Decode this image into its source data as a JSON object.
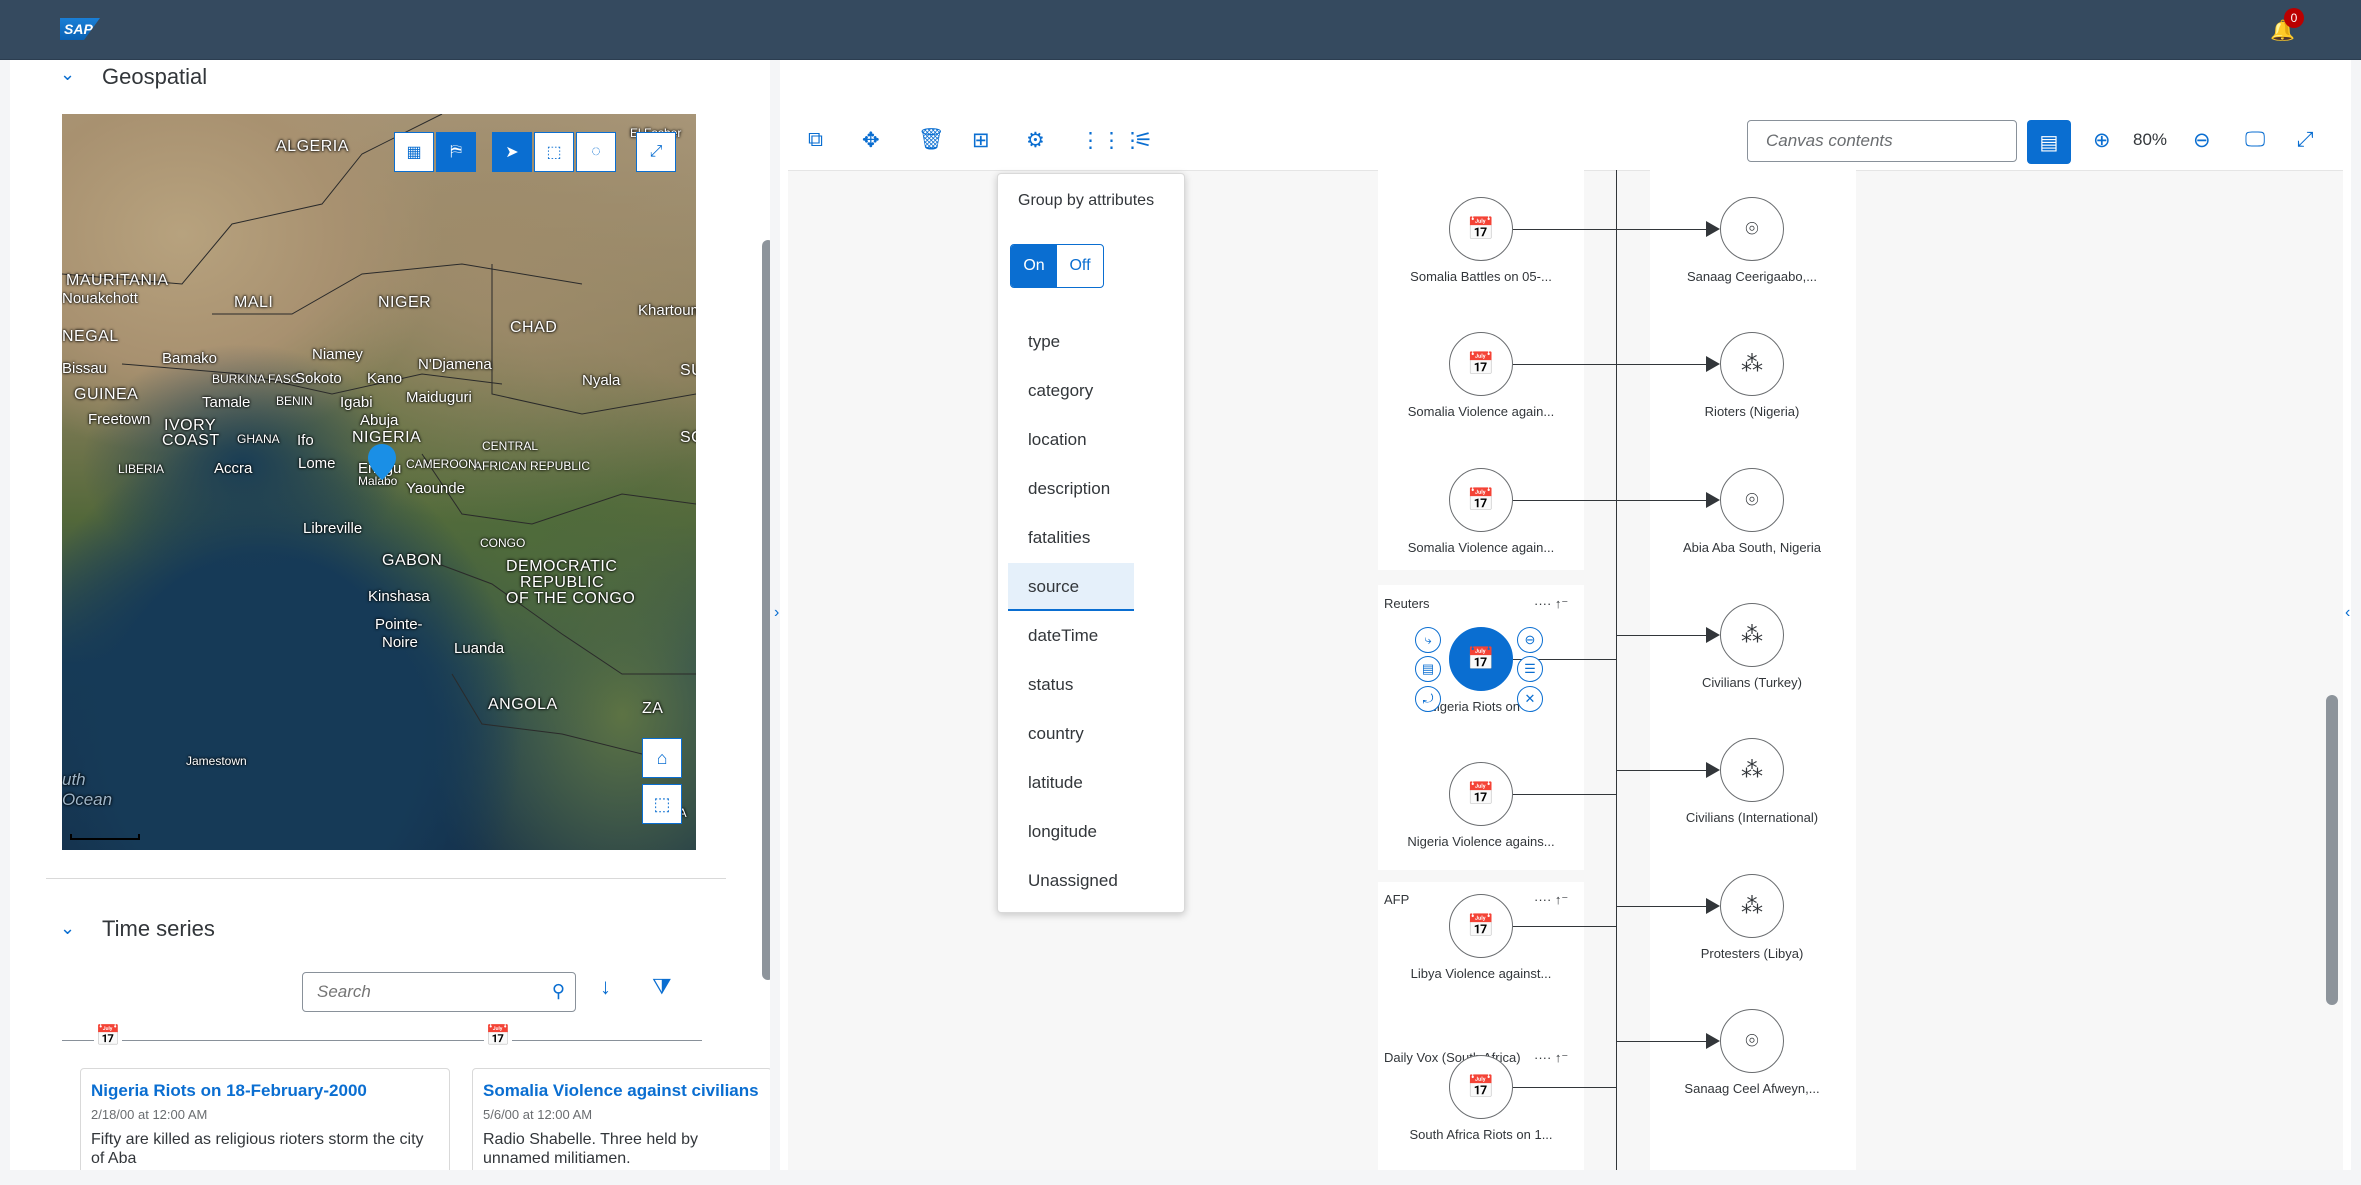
{
  "shell": {
    "logo": "SAP",
    "notifications_count": "0"
  },
  "left": {
    "geospatial_title": "Geospatial",
    "timeseries_title": "Time series",
    "map_labels": [
      {
        "text": "ALGERIA",
        "cls": "big"
      },
      {
        "text": "MAURITANIA",
        "cls": "big"
      },
      {
        "text": "Nouakchott",
        "cls": ""
      },
      {
        "text": "MALI",
        "cls": "big"
      },
      {
        "text": "NIGER",
        "cls": "big"
      },
      {
        "text": "CHAD",
        "cls": "big"
      },
      {
        "text": "Khartoum",
        "cls": ""
      },
      {
        "text": "Niamey",
        "cls": ""
      },
      {
        "text": "NEGAL",
        "cls": "big"
      },
      {
        "text": "Bissau",
        "cls": ""
      },
      {
        "text": "Bamako",
        "cls": ""
      },
      {
        "text": "BURKINA FASO",
        "cls": "sm"
      },
      {
        "text": "Sokoto",
        "cls": ""
      },
      {
        "text": "Kano",
        "cls": ""
      },
      {
        "text": "N'Djamena",
        "cls": ""
      },
      {
        "text": "Nyala",
        "cls": ""
      },
      {
        "text": "GUINEA",
        "cls": "big"
      },
      {
        "text": "Tamale",
        "cls": ""
      },
      {
        "text": "BENIN",
        "cls": "sm"
      },
      {
        "text": "Igabi",
        "cls": ""
      },
      {
        "text": "Maiduguri",
        "cls": ""
      },
      {
        "text": "Abuja",
        "cls": ""
      },
      {
        "text": "Freetown",
        "cls": ""
      },
      {
        "text": "IVORY",
        "cls": "big"
      },
      {
        "text": "COAST",
        "cls": "big"
      },
      {
        "text": "GHANA",
        "cls": "sm"
      },
      {
        "text": "Ifo",
        "cls": ""
      },
      {
        "text": "NIGERIA",
        "cls": "big"
      },
      {
        "text": "CENTRAL",
        "cls": "sm"
      },
      {
        "text": "AFRICAN REPUBLIC",
        "cls": "sm"
      },
      {
        "text": "LIBERIA",
        "cls": "sm"
      },
      {
        "text": "Accra",
        "cls": ""
      },
      {
        "text": "Lome",
        "cls": ""
      },
      {
        "text": "Enugu",
        "cls": ""
      },
      {
        "text": "CAMEROON",
        "cls": "sm"
      },
      {
        "text": "Malabo",
        "cls": "sm"
      },
      {
        "text": "Yaounde",
        "cls": ""
      },
      {
        "text": "Libreville",
        "cls": ""
      },
      {
        "text": "CONGO",
        "cls": "sm"
      },
      {
        "text": "DEMOCRATIC",
        "cls": "big"
      },
      {
        "text": "REPUBLIC",
        "cls": "big"
      },
      {
        "text": "OF THE CONGO",
        "cls": "big"
      },
      {
        "text": "GABON",
        "cls": "big"
      },
      {
        "text": "Kinshasa",
        "cls": ""
      },
      {
        "text": "Pointe-",
        "cls": ""
      },
      {
        "text": "Noire",
        "cls": ""
      },
      {
        "text": "Luanda",
        "cls": ""
      },
      {
        "text": "ANGOLA",
        "cls": "big"
      },
      {
        "text": "Jamestown",
        "cls": "sm"
      },
      {
        "text": "uth",
        "cls": "ocean"
      },
      {
        "text": "Ocean",
        "cls": "ocean"
      },
      {
        "text": "ZIMBA",
        "cls": "sm"
      },
      {
        "text": "SU",
        "cls": "big"
      },
      {
        "text": "SO",
        "cls": "big"
      },
      {
        "text": "ZA",
        "cls": "big"
      },
      {
        "text": "El Fasher",
        "cls": "sm"
      }
    ],
    "search_placeholder": "Search",
    "cards": [
      {
        "title": "Nigeria Riots on 18-February-2000",
        "date": "2/18/00 at 12:00 AM",
        "body": "Fifty are killed as religious rioters storm the city of Aba"
      },
      {
        "title": "Somalia Violence against civilians",
        "date": "5/6/00 at 12:00 AM",
        "body": "Radio Shabelle. Three held by unnamed militiamen."
      }
    ]
  },
  "toolbar": {
    "canvas_search_placeholder": "Canvas contents",
    "zoom": "80%"
  },
  "group_menu": {
    "title": "Group by attributes",
    "on": "On",
    "off": "Off",
    "items": [
      "type",
      "category",
      "location",
      "description",
      "fatalities",
      "source",
      "dateTime",
      "status",
      "country",
      "latitude",
      "longitude",
      "Unassigned"
    ],
    "selected": "source"
  },
  "graph": {
    "lanes": [
      {
        "header": "Reuters"
      },
      {
        "header": "AFP"
      },
      {
        "header": "Daily Vox (South Africa)"
      }
    ],
    "events": [
      "Somalia Battles on 05-...",
      "Somalia Violence again...",
      "Somalia Violence again...",
      "Nigeria Riots on ...",
      "Nigeria Violence agains...",
      "Libya Violence against...",
      "South Africa Riots on 1..."
    ],
    "targets": [
      {
        "label": "Sanaag Ceerigaabo,...",
        "icon": "location"
      },
      {
        "label": "Rioters (Nigeria)",
        "icon": "group"
      },
      {
        "label": "Abia Aba South, Nigeria",
        "icon": "location"
      },
      {
        "label": "Civilians (Turkey)",
        "icon": "group"
      },
      {
        "label": "Civilians (International)",
        "icon": "group"
      },
      {
        "label": "Protesters (Libya)",
        "icon": "group"
      },
      {
        "label": "Sanaag Ceel Afweyn,...",
        "icon": "location"
      }
    ],
    "lane_more": "···· ↑⁻"
  }
}
